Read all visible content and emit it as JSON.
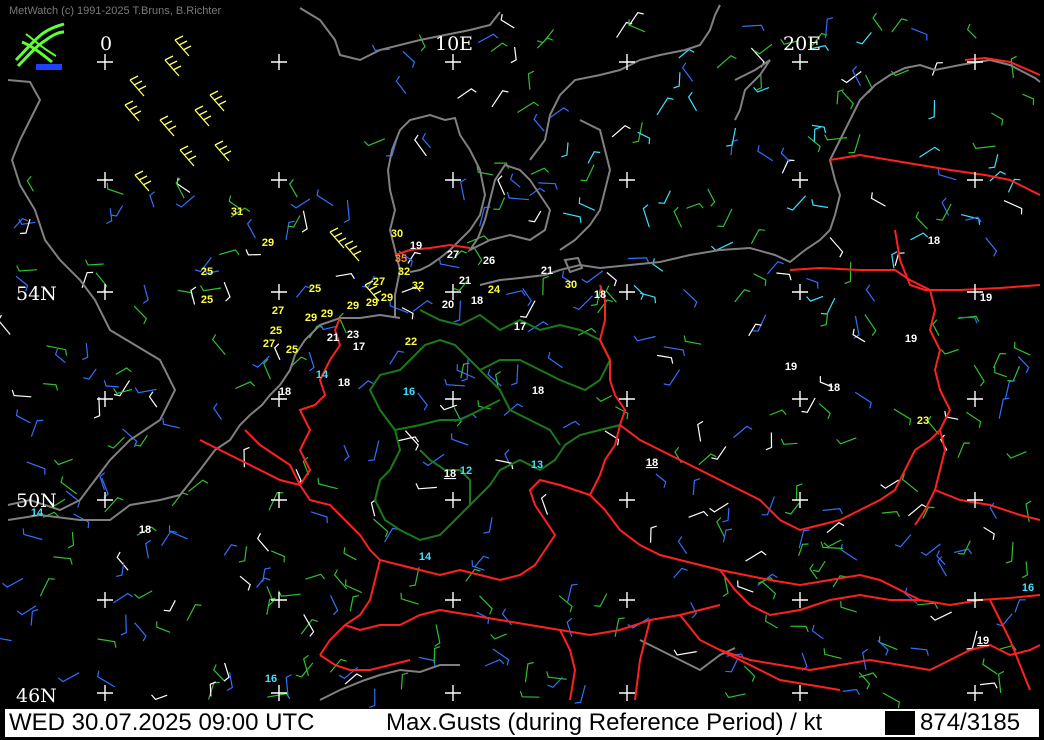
{
  "header": {
    "credit": "MetWatch  (c) 1991-2025 T.Bruns, B.Richter"
  },
  "status_bar": {
    "datetime": "WED 30.07.2025 09:00 UTC",
    "parameter": "Max.Gusts (during Reference Period) / kt",
    "count": "874/3185"
  },
  "grid": {
    "lon_labels": [
      "0",
      "10E",
      "20E"
    ],
    "lat_labels": [
      "54N",
      "50N",
      "46N"
    ]
  },
  "colors": {
    "background": "#000000",
    "coastline": "#808080",
    "border_national": "#ff2020",
    "border_regional": "#1a7a1a",
    "grid_cross": "#ffffff",
    "gust_label_white": "#ffffff",
    "gust_label_yellow": "#ffff40",
    "gust_label_orange": "#ff9020",
    "gust_label_cyan": "#40e0ff",
    "barb_white": "#ffffff",
    "barb_yellow": "#ffff60",
    "barb_green": "#30c030",
    "barb_blue": "#3070ff"
  },
  "gust_labels": [
    {
      "v": "31",
      "c": "yellow"
    },
    {
      "v": "29",
      "c": "yellow"
    },
    {
      "v": "25",
      "c": "yellow"
    },
    {
      "v": "25",
      "c": "yellow"
    },
    {
      "v": "25",
      "c": "yellow"
    },
    {
      "v": "27",
      "c": "yellow"
    },
    {
      "v": "29",
      "c": "yellow"
    },
    {
      "v": "29",
      "c": "yellow"
    },
    {
      "v": "25",
      "c": "yellow"
    },
    {
      "v": "27",
      "c": "yellow"
    },
    {
      "v": "25",
      "c": "yellow"
    },
    {
      "v": "29",
      "c": "yellow"
    },
    {
      "v": "27",
      "c": "yellow"
    },
    {
      "v": "29",
      "c": "yellow"
    },
    {
      "v": "32",
      "c": "yellow"
    },
    {
      "v": "29",
      "c": "yellow"
    },
    {
      "v": "32",
      "c": "yellow"
    },
    {
      "v": "30",
      "c": "yellow"
    },
    {
      "v": "35",
      "c": "orange"
    },
    {
      "v": "19",
      "c": "white"
    },
    {
      "v": "27",
      "c": "white"
    },
    {
      "v": "26",
      "c": "white"
    },
    {
      "v": "21",
      "c": "white"
    },
    {
      "v": "24",
      "c": "yellow"
    },
    {
      "v": "21",
      "c": "white"
    },
    {
      "v": "30",
      "c": "yellow"
    },
    {
      "v": "18",
      "c": "white"
    },
    {
      "v": "20",
      "c": "white"
    },
    {
      "v": "18",
      "c": "white"
    },
    {
      "v": "17",
      "c": "white"
    },
    {
      "v": "21",
      "c": "white"
    },
    {
      "v": "23",
      "c": "white"
    },
    {
      "v": "17",
      "c": "white"
    },
    {
      "v": "22",
      "c": "yellow"
    },
    {
      "v": "14",
      "c": "cyan"
    },
    {
      "v": "18",
      "c": "white"
    },
    {
      "v": "18",
      "c": "white"
    },
    {
      "v": "16",
      "c": "cyan"
    },
    {
      "v": "18",
      "c": "white"
    },
    {
      "v": "18",
      "c": "white",
      "u": true
    },
    {
      "v": "12",
      "c": "cyan"
    },
    {
      "v": "13",
      "c": "cyan"
    },
    {
      "v": "18",
      "c": "white",
      "u": true
    },
    {
      "v": "14",
      "c": "cyan"
    },
    {
      "v": "18",
      "c": "white"
    },
    {
      "v": "14",
      "c": "cyan"
    },
    {
      "v": "16",
      "c": "cyan"
    },
    {
      "v": "18",
      "c": "white"
    },
    {
      "v": "19",
      "c": "white"
    },
    {
      "v": "19",
      "c": "white"
    },
    {
      "v": "19",
      "c": "white"
    },
    {
      "v": "18",
      "c": "white"
    },
    {
      "v": "23",
      "c": "yellow"
    },
    {
      "v": "16",
      "c": "cyan"
    },
    {
      "v": "19",
      "c": "white",
      "u": true
    }
  ]
}
